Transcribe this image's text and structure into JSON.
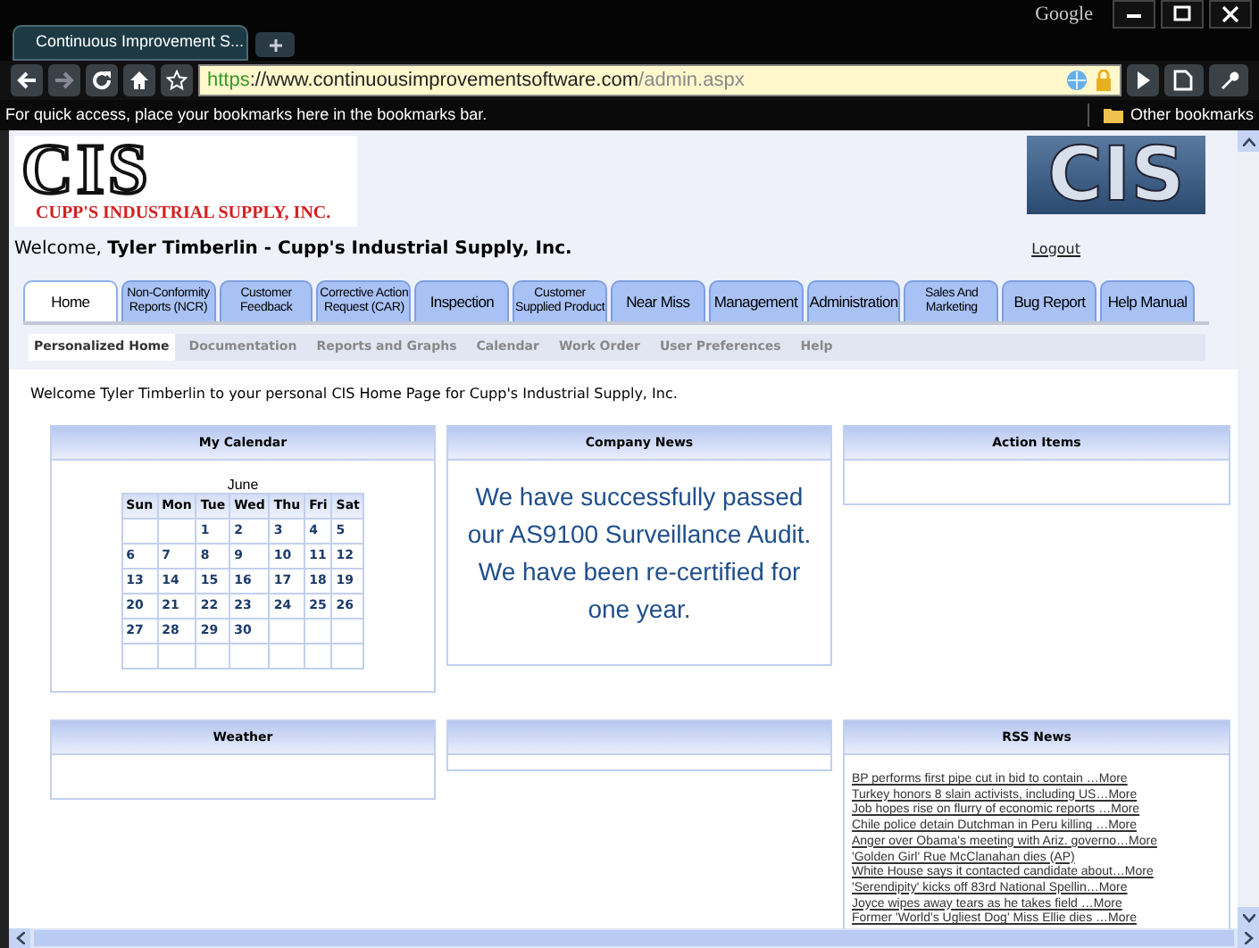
{
  "browser": {
    "tab_title": "Continuous Improvement S...",
    "account": "Google",
    "url": {
      "scheme": "https",
      "host": "://www.continuousimprovementsoftware.com",
      "path": "/admin.aspx"
    },
    "bookmarks_hint": "For quick access, place your bookmarks here in the bookmarks bar.",
    "other_bookmarks": "Other bookmarks"
  },
  "header": {
    "logo_title": "CIS",
    "logo_subtitle": "CUPP'S INDUSTRIAL SUPPLY, INC.",
    "badge": "CIS",
    "welcome_prefix": "Welcome,",
    "welcome_name": "Tyler Timberlin - Cupp's Industrial Supply, Inc.",
    "logout": "Logout"
  },
  "tabs": [
    {
      "label": [
        "Home"
      ],
      "selected": true
    },
    {
      "label": [
        "Non-Conformity",
        "Reports (NCR)"
      ],
      "selected": false
    },
    {
      "label": [
        "Customer",
        "Feedback"
      ],
      "selected": false
    },
    {
      "label": [
        "Corrective Action",
        "Request (CAR)"
      ],
      "selected": false
    },
    {
      "label": [
        "Inspection"
      ],
      "selected": false
    },
    {
      "label": [
        "Customer",
        "Supplied Product"
      ],
      "selected": false
    },
    {
      "label": [
        "Near Miss"
      ],
      "selected": false
    },
    {
      "label": [
        "Management"
      ],
      "selected": false
    },
    {
      "label": [
        "Administration"
      ],
      "selected": false
    },
    {
      "label": [
        "Sales And",
        "Marketing"
      ],
      "selected": false
    },
    {
      "label": [
        "Bug Report"
      ],
      "selected": false
    },
    {
      "label": [
        "Help Manual"
      ],
      "selected": false
    }
  ],
  "subnav": [
    {
      "label": "Personalized Home",
      "selected": true
    },
    {
      "label": "Documentation",
      "selected": false
    },
    {
      "label": "Reports and Graphs",
      "selected": false
    },
    {
      "label": "Calendar",
      "selected": false
    },
    {
      "label": "Work Order",
      "selected": false
    },
    {
      "label": "User Preferences",
      "selected": false
    },
    {
      "label": "Help",
      "selected": false
    }
  ],
  "intro": "Welcome Tyler Timberlin to your personal CIS Home Page for Cupp's Industrial Supply, Inc.",
  "panels": [
    {
      "title": "My Calendar",
      "kind": "calendar",
      "month": "June",
      "weekdays": [
        "Sun",
        "Mon",
        "Tue",
        "Wed",
        "Thu",
        "Fri",
        "Sat"
      ],
      "weeks": [
        [
          {
            "kind": "blank"
          },
          {
            "kind": "blank"
          },
          {
            "kind": "day",
            "text": "1"
          },
          {
            "kind": "day",
            "text": "2"
          },
          {
            "kind": "day",
            "text": "3"
          },
          {
            "kind": "day",
            "text": "4"
          },
          {
            "kind": "day",
            "text": "5"
          }
        ],
        [
          {
            "kind": "day",
            "text": "6"
          },
          {
            "kind": "day",
            "text": "7"
          },
          {
            "kind": "day",
            "text": "8"
          },
          {
            "kind": "day",
            "text": "9"
          },
          {
            "kind": "day",
            "text": "10"
          },
          {
            "kind": "day",
            "text": "11"
          },
          {
            "kind": "day",
            "text": "12"
          }
        ],
        [
          {
            "kind": "day",
            "text": "13"
          },
          {
            "kind": "day",
            "text": "14"
          },
          {
            "kind": "day",
            "text": "15"
          },
          {
            "kind": "day",
            "text": "16"
          },
          {
            "kind": "day",
            "text": "17"
          },
          {
            "kind": "day",
            "text": "18"
          },
          {
            "kind": "day",
            "text": "19"
          }
        ],
        [
          {
            "kind": "day",
            "text": "20"
          },
          {
            "kind": "day",
            "text": "21"
          },
          {
            "kind": "day",
            "text": "22"
          },
          {
            "kind": "day",
            "text": "23"
          },
          {
            "kind": "day",
            "text": "24"
          },
          {
            "kind": "day",
            "text": "25"
          },
          {
            "kind": "day",
            "text": "26"
          }
        ],
        [
          {
            "kind": "day",
            "text": "27"
          },
          {
            "kind": "day",
            "text": "28"
          },
          {
            "kind": "day",
            "text": "29"
          },
          {
            "kind": "day",
            "text": "30"
          },
          {
            "kind": "blank"
          },
          {
            "kind": "blank"
          },
          {
            "kind": "blank"
          }
        ],
        [
          {
            "kind": "blank"
          },
          {
            "kind": "blank"
          },
          {
            "kind": "blank"
          },
          {
            "kind": "blank"
          },
          {
            "kind": "blank"
          },
          {
            "kind": "blank"
          },
          {
            "kind": "blank"
          }
        ]
      ]
    },
    {
      "title": "Company News",
      "kind": "text",
      "text": "We have successfully passed our AS9100 Surveillance Audit. We have been re-certified for one year."
    },
    {
      "title": "Action Items",
      "kind": "empty"
    },
    {
      "title": "Weather",
      "kind": "empty"
    },
    {
      "kind": "blank"
    },
    {
      "title": "RSS News",
      "kind": "links",
      "items": [
        "BP performs first pipe cut in bid to contain …More",
        "Turkey honors 8 slain activists, including US…More",
        "Job hopes rise on flurry of economic reports …More",
        "Chile police detain Dutchman in Peru killing …More",
        "Anger over Obama's meeting with Ariz. governo…More",
        "'Golden Girl' Rue McClanahan dies (AP)",
        "White House says it contacted candidate about…More",
        "'Serendipity' kicks off 83rd National Spellin…More",
        "Joyce wipes away tears as he takes field …More",
        "Former 'World's Ugliest Dog' Miss Ellie dies …More"
      ]
    }
  ]
}
